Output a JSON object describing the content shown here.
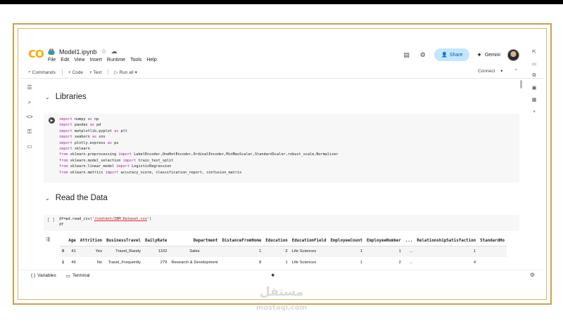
{
  "header": {
    "logo_text": "CO",
    "notebook_title": "Model1.ipynb",
    "menu": [
      "File",
      "Edit",
      "View",
      "Insert",
      "Runtime",
      "Tools",
      "Help"
    ],
    "share_label": "Share",
    "gemini_label": "Gemini"
  },
  "toolbar": {
    "commands_label": "Commands",
    "code_label": "+ Code",
    "text_label": "+ Text",
    "run_all_label": "Run all",
    "connect_label": "Connect"
  },
  "sections": {
    "libraries_title": "Libraries",
    "read_data_title": "Read the Data"
  },
  "cell1": {
    "lines": [
      "import numpy as np",
      "import pandas as pd",
      "import matplotlib.pyplot as plt",
      "import seaborn as sns",
      "import plotly.express as px",
      "import sklearn",
      "from sklearn.preprocessing import LabelEncoder,OneHotEncoder,OrdinalEncoder,MinMaxScaler,StandardScaler,robust_scale,Normalizer",
      "from sklearn.model_selection import train_test_split",
      "from sklearn.linear_model import LogisticRegression",
      "from sklearn.metrics import accuracy_score, classification_report, confusion_matrix"
    ]
  },
  "cell2": {
    "bracket": "[ ]",
    "line1": "df=pd.read_csv('/content/IBM Dataset.csv')",
    "line2": "df"
  },
  "dataframe": {
    "columns": [
      "",
      "Age",
      "Attrition",
      "BusinessTravel",
      "DailyRate",
      "Department",
      "DistanceFromHome",
      "Education",
      "EducationField",
      "EmployeeCount",
      "EmployeeNumber",
      "...",
      "RelationshipSatisfaction",
      "StandardHo"
    ],
    "rows": [
      [
        "0",
        "41",
        "Yes",
        "Travel_Rarely",
        "1102",
        "Sales",
        "1",
        "2",
        "Life Sciences",
        "1",
        "1",
        "...",
        "1",
        ""
      ],
      [
        "1",
        "49",
        "No",
        "Travel_Frequently",
        "279",
        "Research & Development",
        "8",
        "1",
        "Life Sciences",
        "1",
        "2",
        "...",
        "4",
        ""
      ]
    ]
  },
  "bottombar": {
    "variables_label": "Variables",
    "terminal_label": "Terminal"
  },
  "watermark": {
    "arabic": "مستقل",
    "latin": "mostaql.com"
  },
  "colors": {
    "frame_gold": "#c9a24a",
    "share_bg": "#c2e7ff",
    "keyword": "#a626a4"
  }
}
